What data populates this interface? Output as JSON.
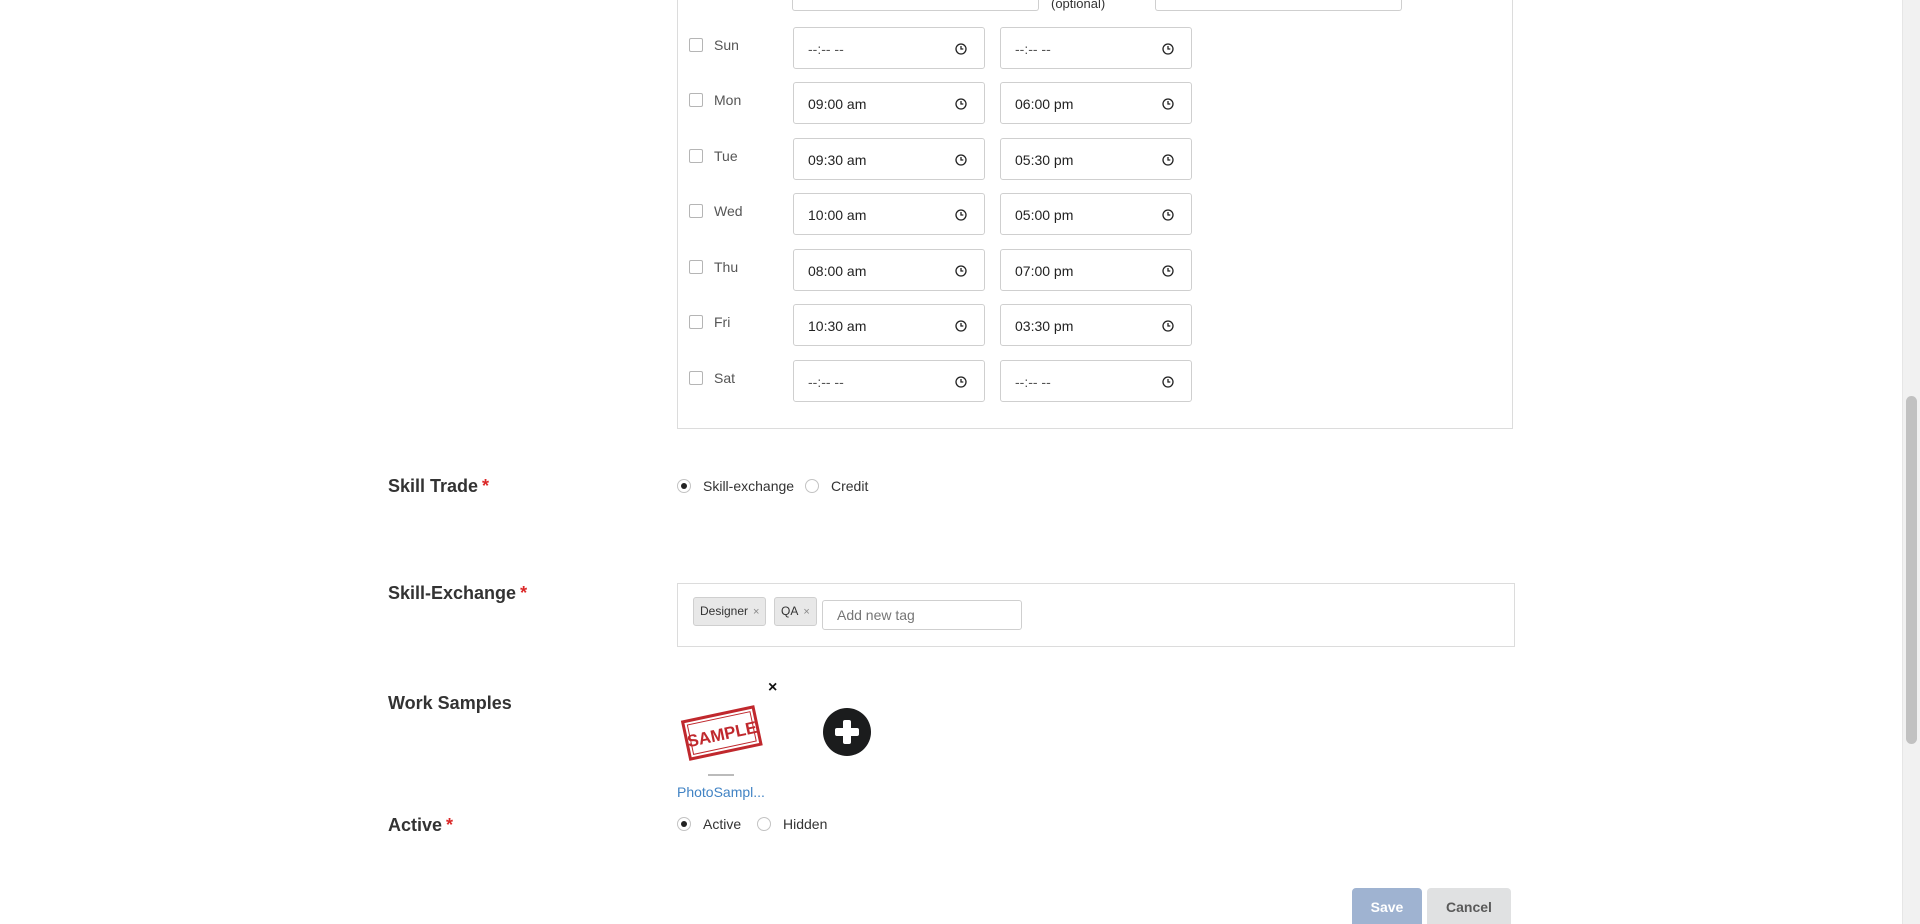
{
  "availability": {
    "optional_label": "(optional)",
    "days": [
      {
        "label": "Sun",
        "start": "--:-- --",
        "end": "--:-- --"
      },
      {
        "label": "Mon",
        "start": "09:00 am",
        "end": "06:00 pm"
      },
      {
        "label": "Tue",
        "start": "09:30 am",
        "end": "05:30 pm"
      },
      {
        "label": "Wed",
        "start": "10:00 am",
        "end": "05:00 pm"
      },
      {
        "label": "Thu",
        "start": "08:00 am",
        "end": "07:00 pm"
      },
      {
        "label": "Fri",
        "start": "10:30 am",
        "end": "03:30 pm"
      },
      {
        "label": "Sat",
        "start": "--:-- --",
        "end": "--:-- --"
      }
    ]
  },
  "skill_trade": {
    "label": "Skill Trade",
    "required_mark": "*",
    "options": [
      {
        "label": "Skill-exchange",
        "checked": true
      },
      {
        "label": "Credit",
        "checked": false
      }
    ]
  },
  "skill_exchange": {
    "label": "Skill-Exchange",
    "required_mark": "*",
    "tags": [
      {
        "label": "Designer",
        "remove": "×"
      },
      {
        "label": "QA",
        "remove": "×"
      }
    ],
    "add_placeholder": "Add new tag"
  },
  "work_samples": {
    "label": "Work Samples",
    "remove_icon": "×",
    "files": [
      {
        "name": "PhotoSampl...",
        "stamp_text": "SAMPLE"
      }
    ],
    "add_icon": "plus-circle-icon"
  },
  "active": {
    "label": "Active",
    "required_mark": "*",
    "options": [
      {
        "label": "Active",
        "checked": true
      },
      {
        "label": "Hidden",
        "checked": false
      }
    ]
  },
  "actions": {
    "save_label": "Save",
    "cancel_label": "Cancel"
  },
  "colors": {
    "required": "#db2828",
    "link": "#4183c4",
    "save_bg": "#9fb3d1",
    "cancel_bg": "#e0e1e2"
  }
}
